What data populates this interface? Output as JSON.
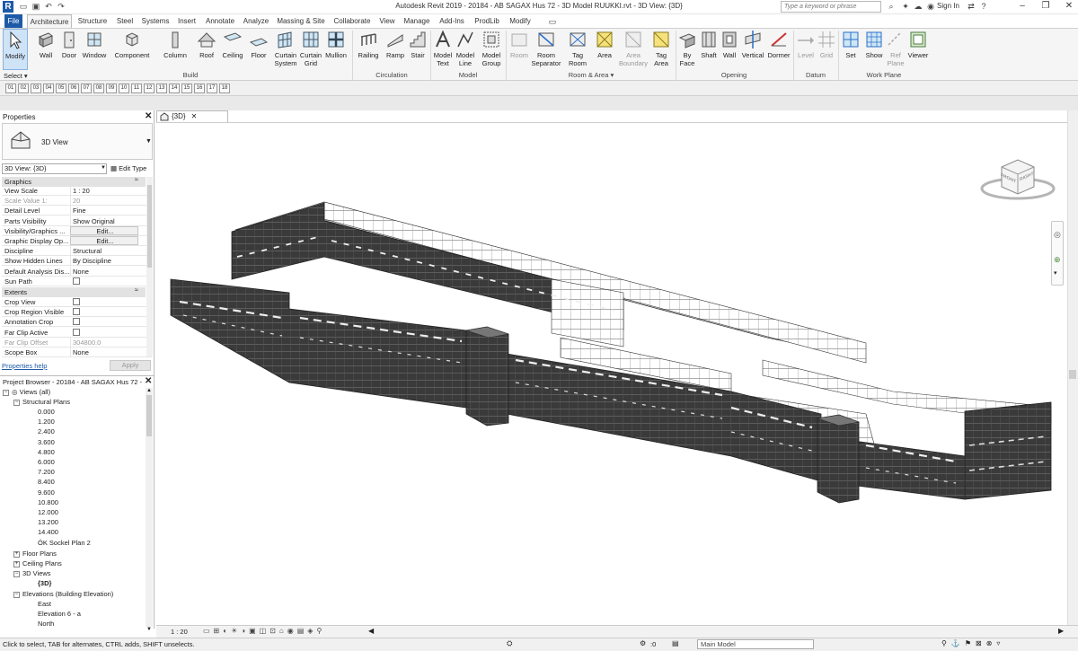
{
  "app": {
    "logo": "R",
    "title": "Autodesk Revit 2019 - 20184 - AB SAGAX Hus 72 - 3D Model RUUKKI.rvt - 3D View: {3D}",
    "search_placeholder": "Type a keyword or phrase",
    "sign_in": "Sign In"
  },
  "tabs": [
    "File",
    "Architecture",
    "Structure",
    "Steel",
    "Systems",
    "Insert",
    "Annotate",
    "Analyze",
    "Massing & Site",
    "Collaborate",
    "View",
    "Manage",
    "Add-Ins",
    "ProdLib",
    "Modify"
  ],
  "ribbon": {
    "select": {
      "modify": "Modify",
      "dropdown": "Select ▾"
    },
    "build": [
      "Wall",
      "Door",
      "Window",
      "Component",
      "Column",
      "Roof",
      "Ceiling",
      "Floor",
      "Curtain System",
      "Curtain Grid",
      "Mullion"
    ],
    "circulation": [
      "Railing",
      "Ramp",
      "Stair"
    ],
    "model": [
      "Model Text",
      "Model Line",
      "Model Group"
    ],
    "room_area": [
      "Room",
      "Room Separator",
      "Tag Room",
      "Area",
      "Area Boundary",
      "Tag Area"
    ],
    "opening": [
      "By Face",
      "Shaft",
      "Wall",
      "Vertical",
      "Dormer"
    ],
    "datum": [
      "Level",
      "Grid"
    ],
    "work_plane": [
      "Set",
      "Show",
      "Ref Plane",
      "Viewer"
    ],
    "panels": {
      "build": "Build",
      "circulation": "Circulation",
      "model": "Model",
      "room_area": "Room & Area ▾",
      "opening": "Opening",
      "datum": "Datum",
      "work_plane": "Work Plane"
    }
  },
  "qat_keys": [
    "01",
    "02",
    "03",
    "04",
    "05",
    "06",
    "07",
    "08",
    "09",
    "10",
    "11",
    "12",
    "13",
    "14",
    "15",
    "16",
    "17",
    "18"
  ],
  "properties": {
    "title": "Properties",
    "type_name": "3D View",
    "instance_selector": "3D View: {3D}",
    "edit_type": "Edit Type",
    "sections": {
      "graphics": "Graphics",
      "extents": "Extents"
    },
    "graphics_rows": [
      {
        "k": "View Scale",
        "v": "1 : 20"
      },
      {
        "k": "Scale Value  1:",
        "v": "20",
        "grey": true
      },
      {
        "k": "Detail Level",
        "v": "Fine"
      },
      {
        "k": "Parts Visibility",
        "v": "Show Original"
      },
      {
        "k": "Visibility/Graphics ...",
        "v": "Edit...",
        "btn": true
      },
      {
        "k": "Graphic Display Op...",
        "v": "Edit...",
        "btn": true
      },
      {
        "k": "Discipline",
        "v": "Structural"
      },
      {
        "k": "Show Hidden Lines",
        "v": "By Discipline"
      },
      {
        "k": "Default Analysis Dis...",
        "v": "None"
      },
      {
        "k": "Sun Path",
        "v": "",
        "chk": true
      }
    ],
    "extents_rows": [
      {
        "k": "Crop View",
        "v": "",
        "chk": true
      },
      {
        "k": "Crop Region Visible",
        "v": "",
        "chk": true
      },
      {
        "k": "Annotation Crop",
        "v": "",
        "chk": true
      },
      {
        "k": "Far Clip Active",
        "v": "",
        "chk": true
      },
      {
        "k": "Far Clip Offset",
        "v": "304800.0",
        "grey": true
      },
      {
        "k": "Scope Box",
        "v": "None"
      }
    ],
    "help_link": "Properties help",
    "apply": "Apply"
  },
  "browser": {
    "title": "Project Browser - 20184 - AB SAGAX Hus 72 - ...",
    "views_root": "Views (all)",
    "structural_plans": "Structural Plans",
    "levels": [
      "0.000",
      "1.200",
      "2.400",
      "3.600",
      "4.800",
      "6.000",
      "7.200",
      "8.400",
      "9.600",
      "10.800",
      "12.000",
      "13.200",
      "14.400",
      "ÖK Sockel Plan 2"
    ],
    "floor_plans": "Floor Plans",
    "ceiling_plans": "Ceiling Plans",
    "views_3d": "3D Views",
    "view_3d_item": "{3D}",
    "elevations": "Elevations (Building Elevation)",
    "elevation_items": [
      "East",
      "Elevation 6 - a",
      "North"
    ]
  },
  "view": {
    "tab_label": "{3D}",
    "viewcube_top": "FRONT",
    "viewcube_right": "RIGHT",
    "scale": "1 : 20"
  },
  "status": {
    "hint": "Click to select, TAB for alternates, CTRL adds, SHIFT unselects.",
    "filter_count": ":0",
    "model": "Main Model"
  },
  "colors": {
    "file_tab": "#1d5aa8",
    "wall_dark": "#3a3a3a",
    "wall_mid": "#565656"
  }
}
